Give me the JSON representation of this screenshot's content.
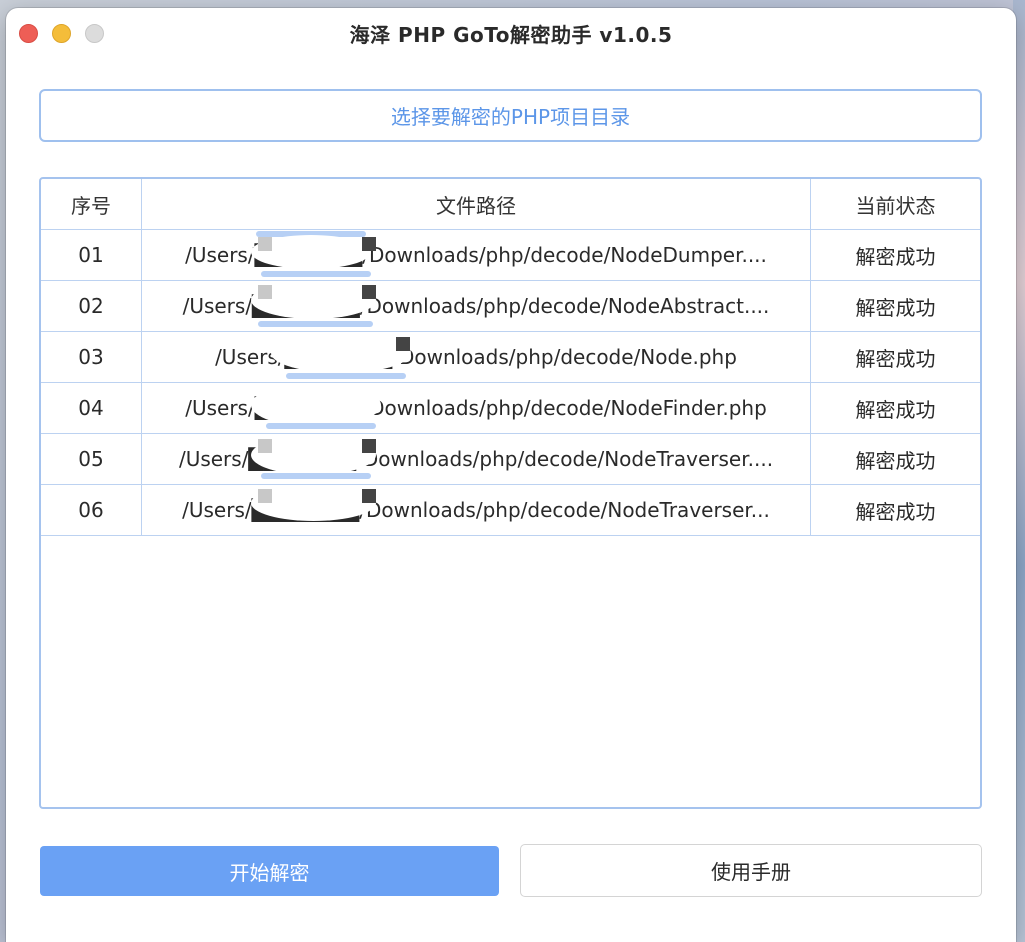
{
  "window": {
    "title": "海泽 PHP GoTo解密助手 v1.0.5"
  },
  "toolbar": {
    "choose_dir_label": "选择要解密的PHP项目目录"
  },
  "table": {
    "headers": [
      "序号",
      "文件路径",
      "当前状态"
    ],
    "rows": [
      {
        "index": "01",
        "path": "/Users/███████/Downloads/php/decode/NodeDumper....",
        "status": "解密成功"
      },
      {
        "index": "02",
        "path": "/Users/███████/Downloads/php/decode/NodeAbstract....",
        "status": "解密成功"
      },
      {
        "index": "03",
        "path": "/Users/███████/Downloads/php/decode/Node.php",
        "status": "解密成功"
      },
      {
        "index": "04",
        "path": "/Users/███████/Downloads/php/decode/NodeFinder.php",
        "status": "解密成功"
      },
      {
        "index": "05",
        "path": "/Users/███████/Downloads/php/decode/NodeTraverser....",
        "status": "解密成功"
      },
      {
        "index": "06",
        "path": "/Users/███████/Downloads/php/decode/NodeTraverser...",
        "status": "解密成功"
      }
    ]
  },
  "actions": {
    "start_label": "开始解密",
    "manual_label": "使用手册"
  },
  "colors": {
    "accent": "#6aa1f4",
    "accent_text": "#5c96e8",
    "border_blue": "#a5c3ee"
  }
}
